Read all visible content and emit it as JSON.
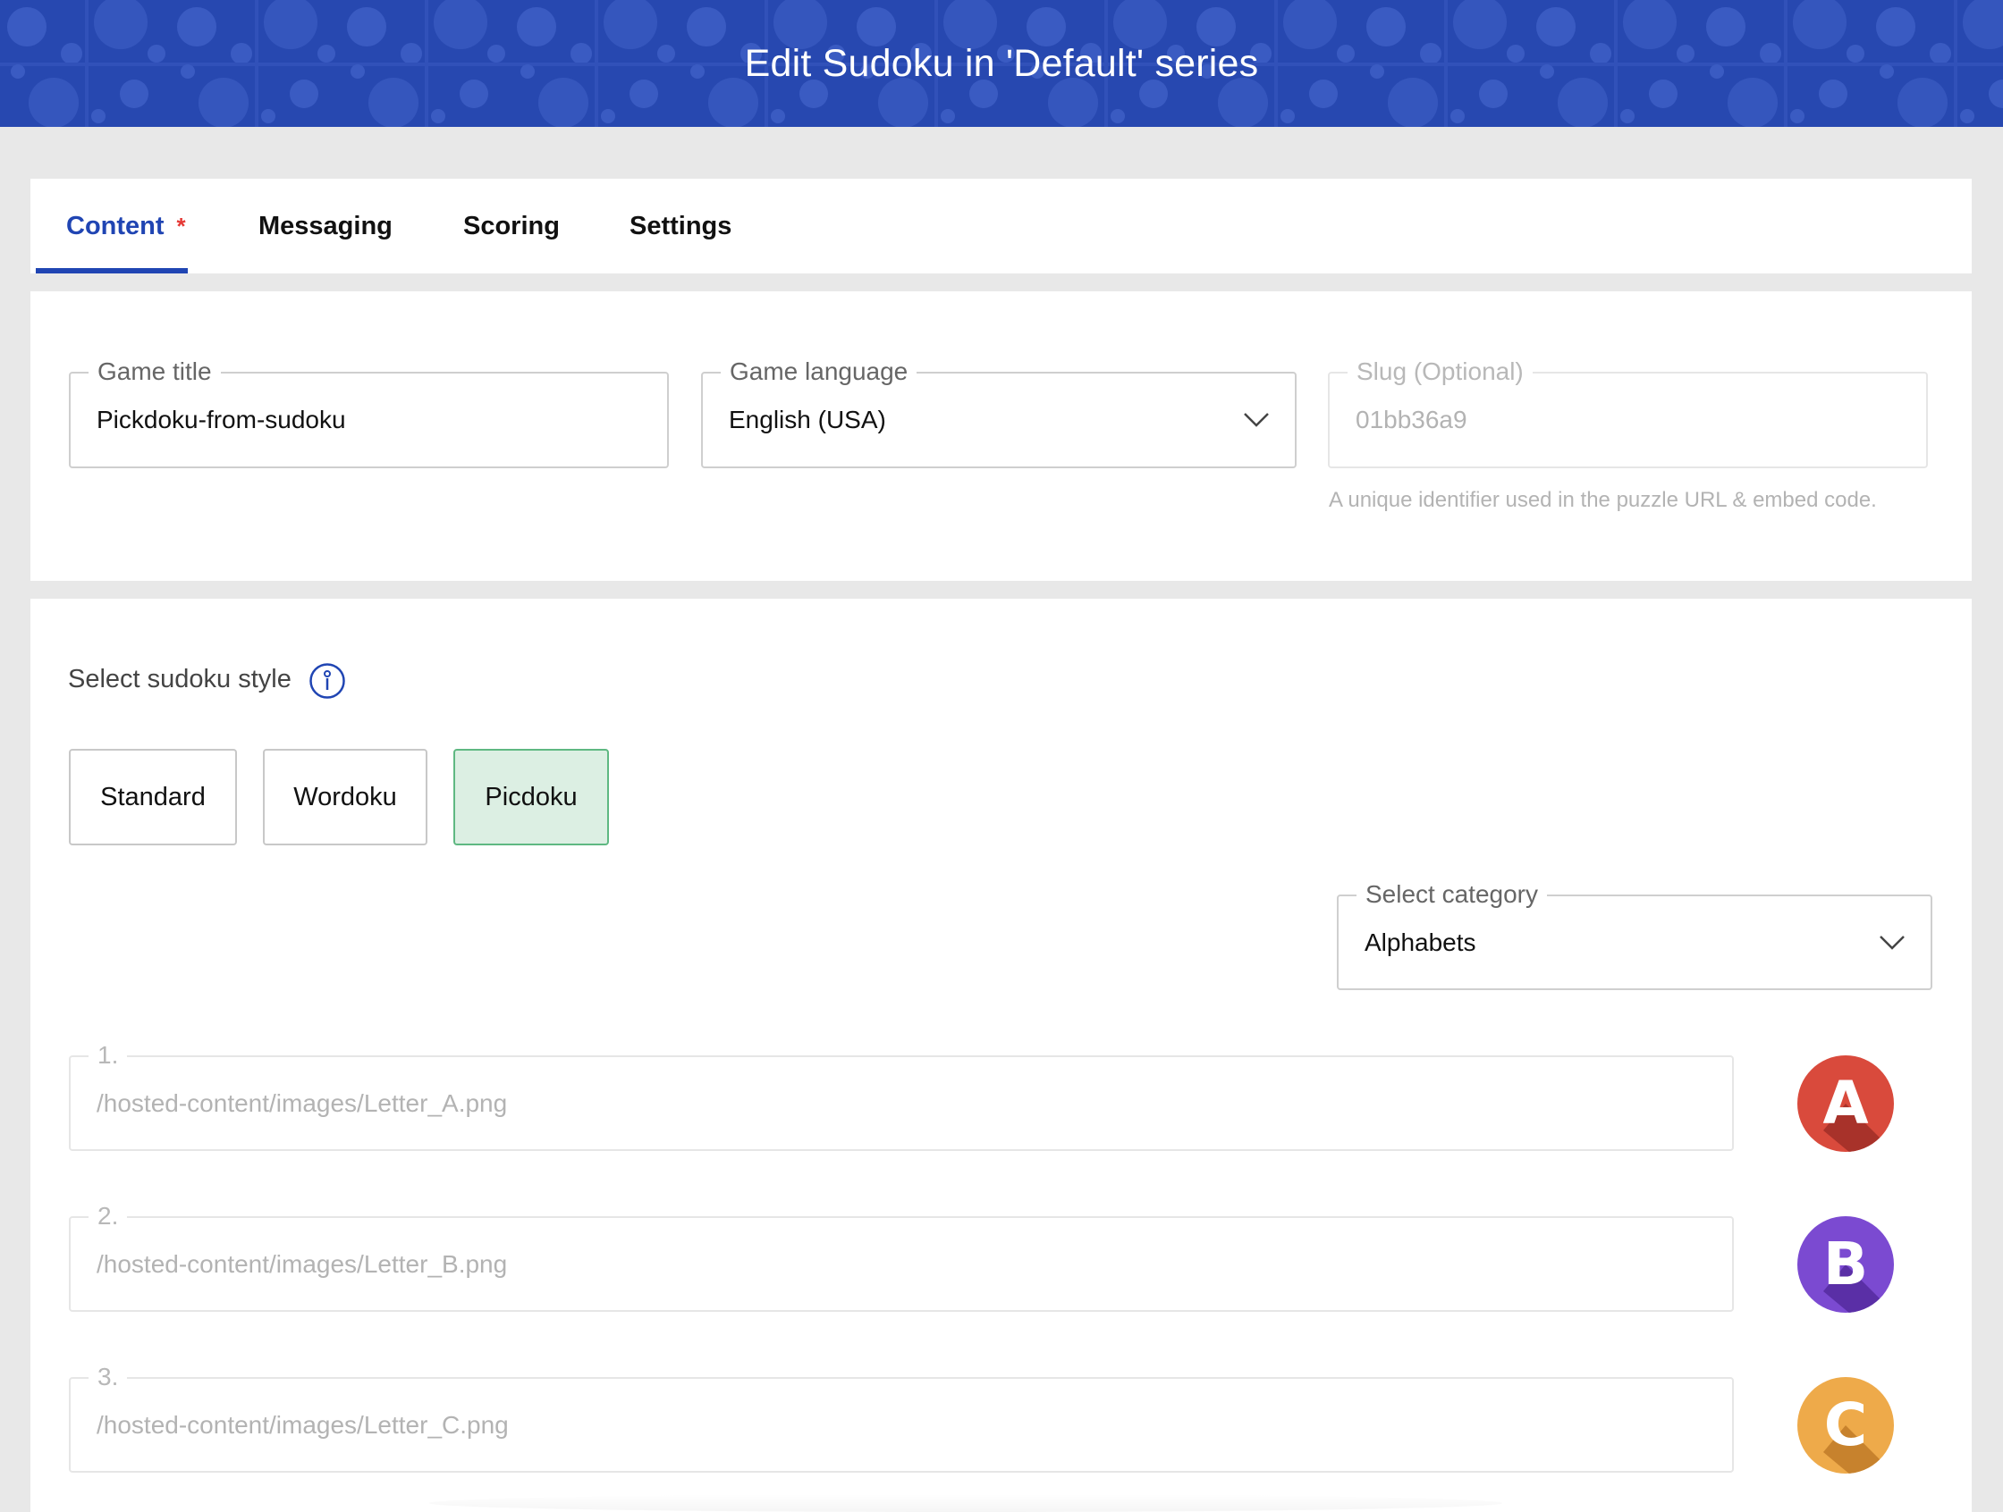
{
  "header": {
    "title": "Edit Sudoku in 'Default' series"
  },
  "tabs": [
    {
      "label": "Content",
      "required_marker": "*",
      "active": true
    },
    {
      "label": "Messaging"
    },
    {
      "label": "Scoring"
    },
    {
      "label": "Settings"
    }
  ],
  "details": {
    "game_title": {
      "label": "Game title",
      "value": "Pickdoku-from-sudoku"
    },
    "game_language": {
      "label": "Game language",
      "value": "English (USA)"
    },
    "slug": {
      "label": "Slug (Optional)",
      "value": "01bb36a9",
      "helper": "A unique identifier used in the puzzle URL & embed code."
    }
  },
  "style": {
    "label": "Select sudoku style",
    "options": [
      "Standard",
      "Wordoku",
      "Picdoku"
    ],
    "selected": "Picdoku"
  },
  "category": {
    "label": "Select category",
    "value": "Alphabets"
  },
  "images": [
    {
      "label": "1.",
      "path": "/hosted-content/images/Letter_A.png",
      "letter": "A",
      "color": "#d94a3c",
      "shade": "#a8322a"
    },
    {
      "label": "2.",
      "path": "/hosted-content/images/Letter_B.png",
      "letter": "B",
      "color": "#7b4ad1",
      "shade": "#5a2fa6"
    },
    {
      "label": "3.",
      "path": "/hosted-content/images/Letter_C.png",
      "letter": "C",
      "color": "#eeaa4a",
      "shade": "#c7822d"
    }
  ],
  "colors": {
    "banner": "#2748b0",
    "accent": "#2045b3",
    "selected_bg": "#dcefe3",
    "required": "#e53935"
  }
}
